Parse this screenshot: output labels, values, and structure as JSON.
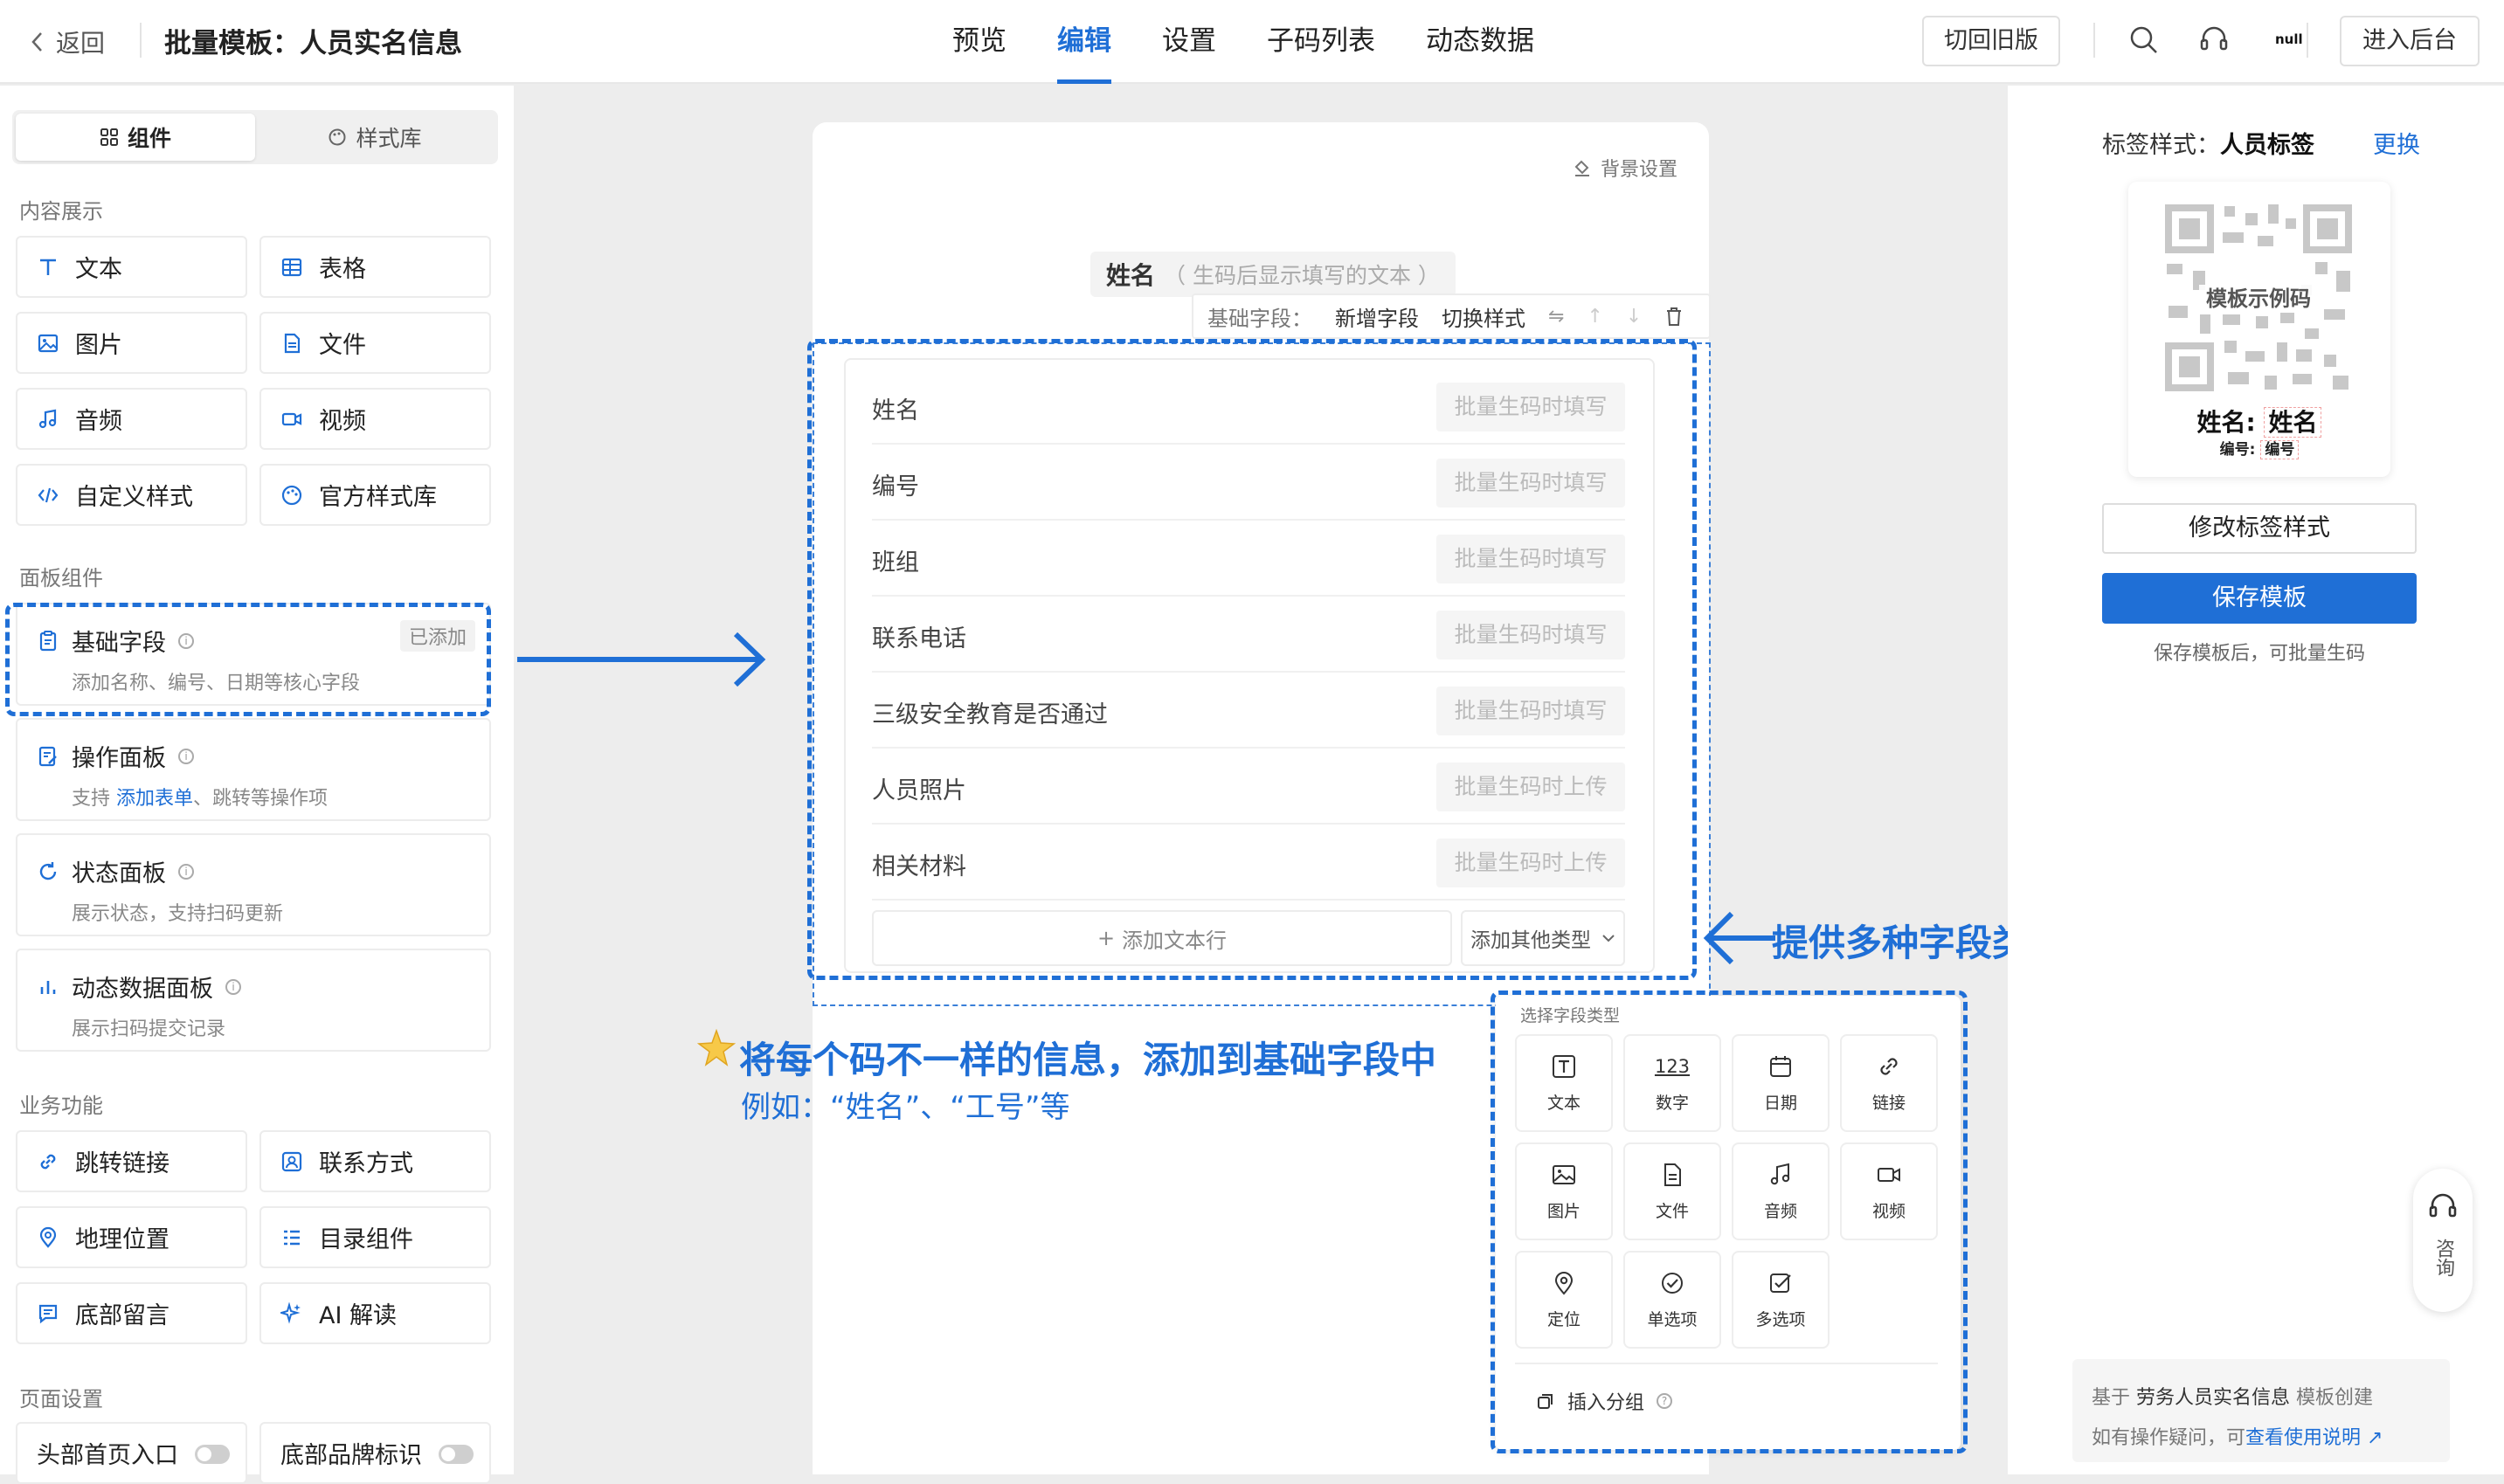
{
  "topbar": {
    "back_label": "返回",
    "title": "批量模板：人员实名信息",
    "tabs": [
      {
        "label": "预览",
        "active": false
      },
      {
        "label": "编辑",
        "active": true
      },
      {
        "label": "设置",
        "active": false
      },
      {
        "label": "子码列表",
        "active": false
      },
      {
        "label": "动态数据",
        "active": false
      }
    ],
    "old_version_label": "切回旧版",
    "null_label": "null",
    "admin_label": "进入后台"
  },
  "sidebar": {
    "tab_components": "组件",
    "tab_style_library": "样式库",
    "section_content": "内容展示",
    "content_items": [
      {
        "label": "文本",
        "icon": "text-t-icon"
      },
      {
        "label": "表格",
        "icon": "table-icon"
      },
      {
        "label": "图片",
        "icon": "image-icon"
      },
      {
        "label": "文件",
        "icon": "file-icon"
      },
      {
        "label": "音频",
        "icon": "music-note-icon"
      },
      {
        "label": "视频",
        "icon": "video-camera-icon"
      },
      {
        "label": "自定义样式",
        "icon": "code-icon"
      },
      {
        "label": "官方样式库",
        "icon": "palette-icon"
      }
    ],
    "section_panels": "面板组件",
    "panels": [
      {
        "title": "基础字段",
        "desc": "添加名称、编号、日期等核心字段",
        "badge": "已添加"
      },
      {
        "title": "操作面板",
        "desc_prefix": "支持 ",
        "desc_link": "添加表单",
        "desc_suffix": "、跳转等操作项"
      },
      {
        "title": "状态面板",
        "desc": "展示状态，支持扫码更新"
      },
      {
        "title": "动态数据面板",
        "desc": "展示扫码提交记录"
      }
    ],
    "section_business": "业务功能",
    "business_items": [
      {
        "label": "跳转链接",
        "icon": "link-icon"
      },
      {
        "label": "联系方式",
        "icon": "contact-card-icon"
      },
      {
        "label": "地理位置",
        "icon": "location-pin-icon"
      },
      {
        "label": "目录组件",
        "icon": "list-icon"
      },
      {
        "label": "底部留言",
        "icon": "comment-icon"
      },
      {
        "label": "AI 解读",
        "icon": "sparkle-icon"
      }
    ],
    "section_page": "页面设置",
    "page_items": [
      {
        "label": "头部首页入口",
        "on": false
      },
      {
        "label": "底部品牌标识",
        "on": false
      }
    ]
  },
  "canvas": {
    "bg_settings": "背景设置",
    "name_label": "姓名",
    "name_hint": "（ 生码后显示填写的文本 ）",
    "toolbar": {
      "basic_field": "基础字段：",
      "add_field": "新增字段",
      "switch_style": "切换样式"
    },
    "fields": [
      {
        "name": "姓名",
        "placeholder": "批量生码时填写"
      },
      {
        "name": "编号",
        "placeholder": "批量生码时填写"
      },
      {
        "name": "班组",
        "placeholder": "批量生码时填写"
      },
      {
        "name": "联系电话",
        "placeholder": "批量生码时填写"
      },
      {
        "name": "三级安全教育是否通过",
        "placeholder": "批量生码时填写"
      },
      {
        "name": "人员照片",
        "placeholder": "批量生码时上传"
      },
      {
        "name": "相关材料",
        "placeholder": "批量生码时上传"
      }
    ],
    "add_text_row": "添加文本行",
    "add_other_type": "添加其他类型"
  },
  "type_popup": {
    "title": "选择字段类型",
    "items": [
      {
        "label": "文本",
        "icon": "text-box-icon"
      },
      {
        "label": "数字",
        "icon": "number-123-icon"
      },
      {
        "label": "日期",
        "icon": "calendar-icon"
      },
      {
        "label": "链接",
        "icon": "link-icon"
      },
      {
        "label": "图片",
        "icon": "image-icon"
      },
      {
        "label": "文件",
        "icon": "file-icon"
      },
      {
        "label": "音频",
        "icon": "music-note-icon"
      },
      {
        "label": "视频",
        "icon": "video-camera-icon"
      },
      {
        "label": "定位",
        "icon": "location-pin-icon"
      },
      {
        "label": "单选项",
        "icon": "check-circle-icon"
      },
      {
        "label": "多选项",
        "icon": "check-square-icon"
      }
    ],
    "number_glyph": "123",
    "insert_group": "插入分组"
  },
  "annotations": {
    "right_note": "提供多种字段类型，可按需添加",
    "main_note": "将每个码不一样的信息，添加到基础字段中",
    "sub_note": "例如：“姓名”、“工号”等",
    "color": "#1f6fd6"
  },
  "right_panel": {
    "tag_style_prefix": "标签样式：",
    "tag_style_name": "人员标签",
    "change": "更换",
    "qr_text": "模板示例码",
    "tag_name_label": "姓名:",
    "tag_name_value": "姓名",
    "tag_no_label": "编号:",
    "tag_no_value": "编号",
    "edit_tag_style": "修改标签样式",
    "save_template": "保存模板",
    "save_hint": "保存模板后，可批量生码",
    "consult": "咨询",
    "base_prefix": "基于 ",
    "base_template": "劳务人员实名信息",
    "base_suffix": " 模板创建",
    "help_prefix": "如有操作疑问，可",
    "help_link": "查看使用说明"
  },
  "colors": {
    "accent": "#1f6fd6",
    "panel_bg": "#ffffff",
    "workspace_bg": "#ededed"
  }
}
